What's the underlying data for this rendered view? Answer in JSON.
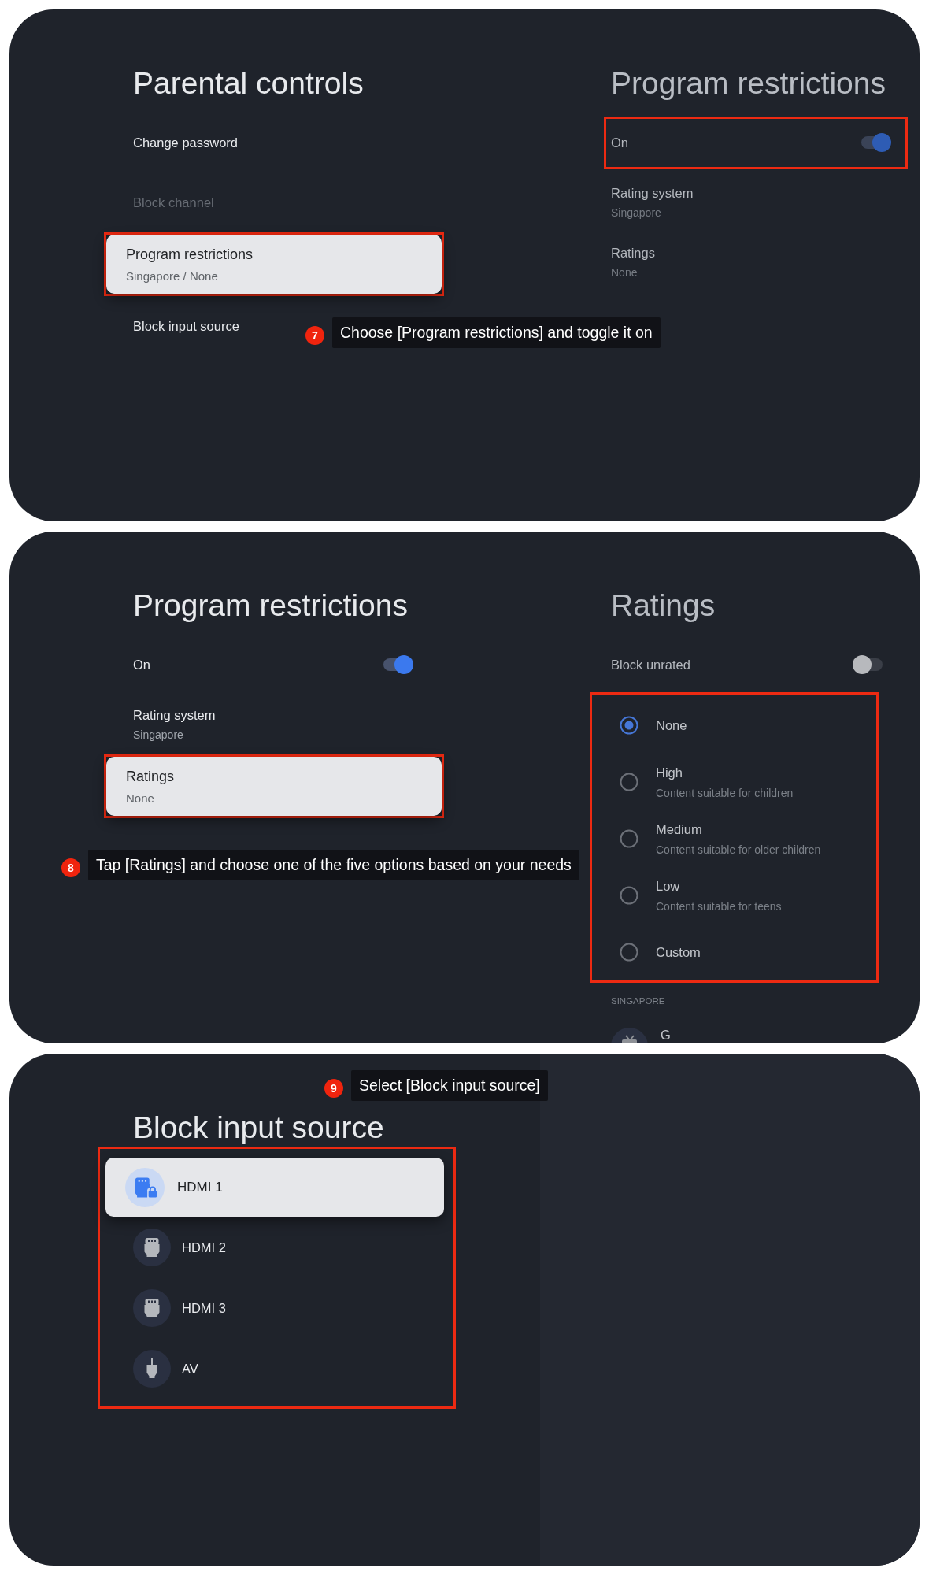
{
  "panels": [
    {
      "left": {
        "title": "Parental controls",
        "items": [
          {
            "kind": "entry",
            "label": "Change password",
            "selected": false,
            "disabled": false,
            "highlighted": false
          },
          {
            "kind": "entry",
            "label": "Block channel",
            "selected": false,
            "disabled": true,
            "highlighted": false
          },
          {
            "kind": "entry",
            "label": "Program restrictions",
            "value": "Singapore / None",
            "selected": true,
            "disabled": false,
            "highlighted": true
          },
          {
            "kind": "entry",
            "label": "Block input source",
            "selected": false,
            "disabled": false,
            "highlighted": false
          }
        ]
      },
      "right": {
        "title": "Program restrictions",
        "items": [
          {
            "kind": "toggle",
            "label": "On",
            "on": true,
            "highlighted": true
          },
          {
            "kind": "entry",
            "label": "Rating system",
            "value": "Singapore",
            "selected": false,
            "disabled": false,
            "highlighted": false
          },
          {
            "kind": "entry",
            "label": "Ratings",
            "value": "None",
            "selected": false,
            "disabled": false,
            "highlighted": false
          }
        ]
      },
      "callout": {
        "step": "7",
        "text": "Choose [Program restrictions] and toggle it on"
      }
    },
    {
      "left": {
        "title": "Program restrictions",
        "items": [
          {
            "kind": "toggle",
            "label": "On",
            "on": true,
            "highlighted": false
          },
          {
            "kind": "entry",
            "label": "Rating system",
            "value": "Singapore",
            "selected": false,
            "disabled": false,
            "highlighted": false
          },
          {
            "kind": "entry",
            "label": "Ratings",
            "value": "None",
            "selected": true,
            "disabled": false,
            "highlighted": true
          }
        ]
      },
      "right": {
        "title": "Ratings",
        "items": [
          {
            "kind": "toggle",
            "label": "Block unrated",
            "on": false,
            "highlighted": false
          },
          {
            "kind": "radio_group",
            "highlighted": true,
            "options": [
              {
                "label": "None",
                "selected": true
              },
              {
                "label": "High",
                "description": "Content suitable for children",
                "selected": false
              },
              {
                "label": "Medium",
                "description": "Content suitable for older children",
                "selected": false
              },
              {
                "label": "Low",
                "description": "Content suitable for teens",
                "selected": false
              },
              {
                "label": "Custom",
                "selected": false
              }
            ]
          },
          {
            "kind": "section",
            "label": "SINGAPORE"
          },
          {
            "kind": "rating",
            "label": "G"
          }
        ]
      },
      "callout": {
        "step": "8",
        "text": "Tap [Ratings] and choose one of the five options based on your needs"
      }
    },
    {
      "left": {
        "title": "Block input source",
        "items": [
          {
            "kind": "source_list",
            "highlighted": true,
            "sources": [
              {
                "kind": "hdmi",
                "label": "HDMI 1",
                "selected": true,
                "locked": true
              },
              {
                "kind": "hdmi",
                "label": "HDMI 2",
                "selected": false,
                "locked": false
              },
              {
                "kind": "hdmi",
                "label": "HDMI 3",
                "selected": false,
                "locked": false
              },
              {
                "kind": "av",
                "label": "AV",
                "selected": false,
                "locked": false
              }
            ]
          }
        ]
      },
      "callout": {
        "step": "9",
        "text": "Select [Block input source]"
      }
    }
  ]
}
